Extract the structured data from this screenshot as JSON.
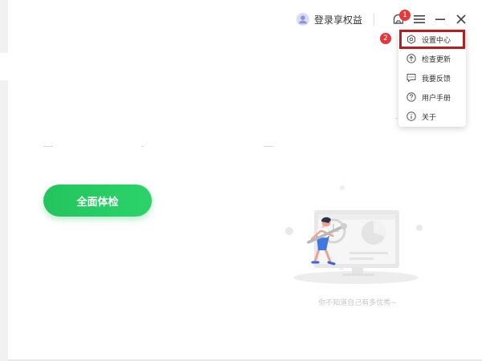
{
  "header": {
    "login_label": "登录享权益",
    "notification_badge": "1"
  },
  "menu": {
    "items": [
      {
        "label": "设置中心",
        "icon": "gear-icon"
      },
      {
        "label": "检查更新",
        "icon": "upload-arrow-icon"
      },
      {
        "label": "我要反馈",
        "icon": "chat-bubble-icon"
      },
      {
        "label": "用户手册",
        "icon": "question-icon"
      },
      {
        "label": "关于",
        "icon": "info-icon"
      }
    ],
    "highlight_index": 0,
    "highlight_badge": "2"
  },
  "main": {
    "scan_button_label": "全面体检",
    "slogan": "你不知道自己有多优秀~"
  },
  "colors": {
    "accent_green": "#23c45e",
    "marker_red": "#e8363a",
    "highlight_border": "#b51f1f"
  }
}
